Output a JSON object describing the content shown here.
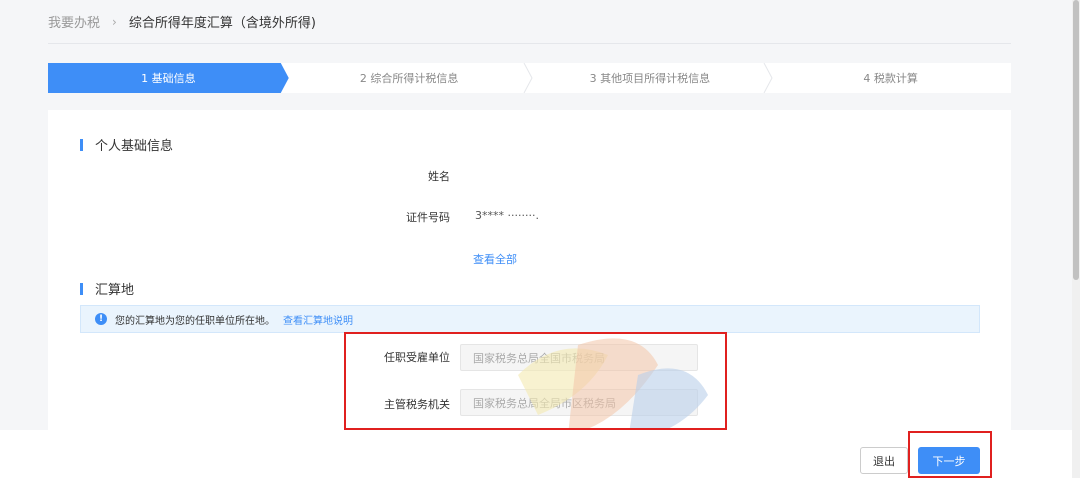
{
  "breadcrumb": {
    "home": "我要办税",
    "separator": "›",
    "current": "综合所得年度汇算（含境外所得)"
  },
  "steps": [
    {
      "label": "1 基础信息",
      "active": true
    },
    {
      "label": "2 综合所得计税信息",
      "active": false
    },
    {
      "label": "3 其他项目所得计税信息",
      "active": false
    },
    {
      "label": "4 税款计算",
      "active": false
    }
  ],
  "personal": {
    "title": "个人基础信息",
    "name_label": "姓名",
    "name_value": "",
    "id_label": "证件号码",
    "id_value": "3**** ········.",
    "view_all": "查看全部"
  },
  "settlement": {
    "title": "汇算地",
    "notice_text": "您的汇算地为您的任职单位所在地。",
    "notice_link": "查看汇算地说明",
    "employer_label": "任职受雇单位",
    "employer_value": "国家税务总局全国市税务局",
    "authority_label": "主管税务机关",
    "authority_value": "国家税务总局全局市区税务局"
  },
  "actions": {
    "exit": "退出",
    "next": "下一步"
  },
  "colors": {
    "accent": "#3e8ef7",
    "highlight_border": "#e0201f"
  }
}
